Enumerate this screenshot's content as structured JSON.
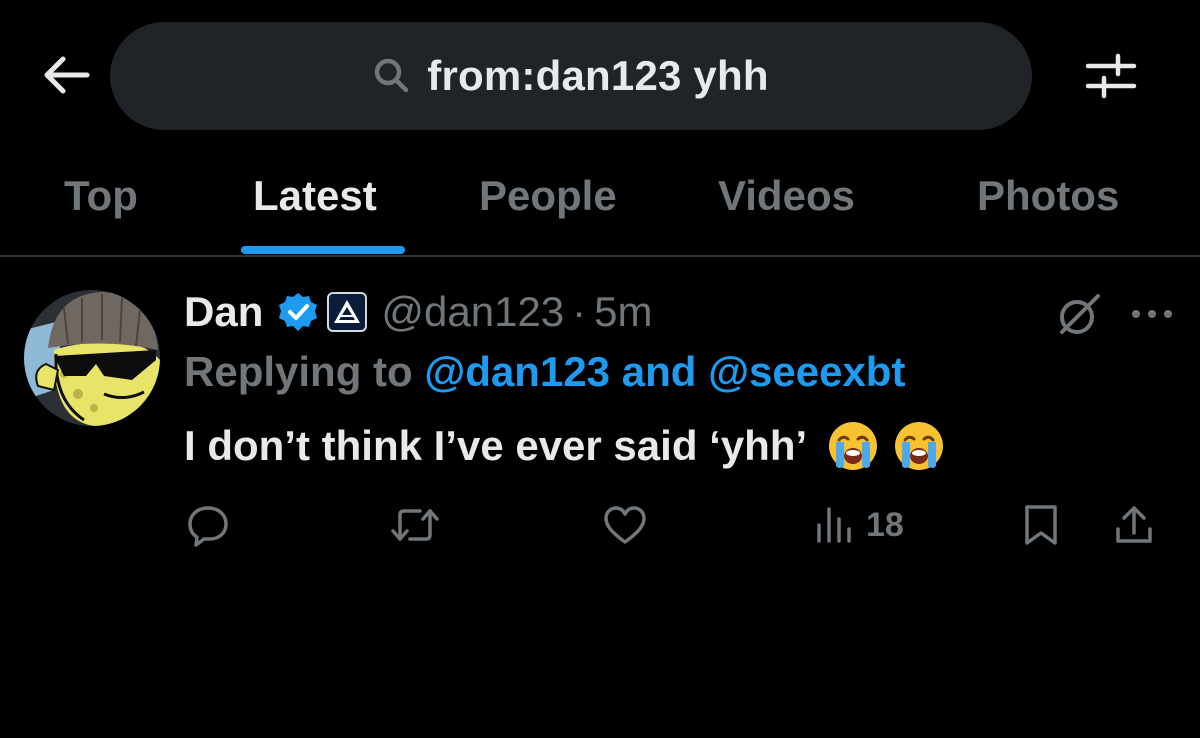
{
  "search": {
    "query": "from:dan123 yhh"
  },
  "tabs": [
    {
      "label": "Top"
    },
    {
      "label": "Latest"
    },
    {
      "label": "People"
    },
    {
      "label": "Videos"
    },
    {
      "label": "Photos"
    }
  ],
  "active_tab": "Latest",
  "tweet": {
    "author_name": "Dan",
    "handle": "@dan123",
    "separator": "·",
    "time": "5m",
    "replying_prefix": "Replying to ",
    "replying_mention_1": "@dan123",
    "replying_joiner": " and ",
    "replying_mention_2": "@seeexbt",
    "text": "I don’t think I’ve ever said ‘yhh’",
    "emojis": [
      "loudly-crying-face",
      "loudly-crying-face"
    ],
    "views": "18"
  },
  "colors": {
    "background": "#000000",
    "accent": "#1d9bf0",
    "muted": "#71767b",
    "text": "#e7e9ea",
    "search_bg": "#202327"
  },
  "icons": {
    "back": "arrow-left-icon",
    "search": "search-icon",
    "filter": "sliders-icon",
    "verified": "verified-badge-icon",
    "grok": "grok-icon",
    "more": "more-icon",
    "reply": "reply-icon",
    "repost": "repost-icon",
    "like": "like-icon",
    "views": "views-icon",
    "bookmark": "bookmark-icon",
    "share": "share-icon"
  }
}
